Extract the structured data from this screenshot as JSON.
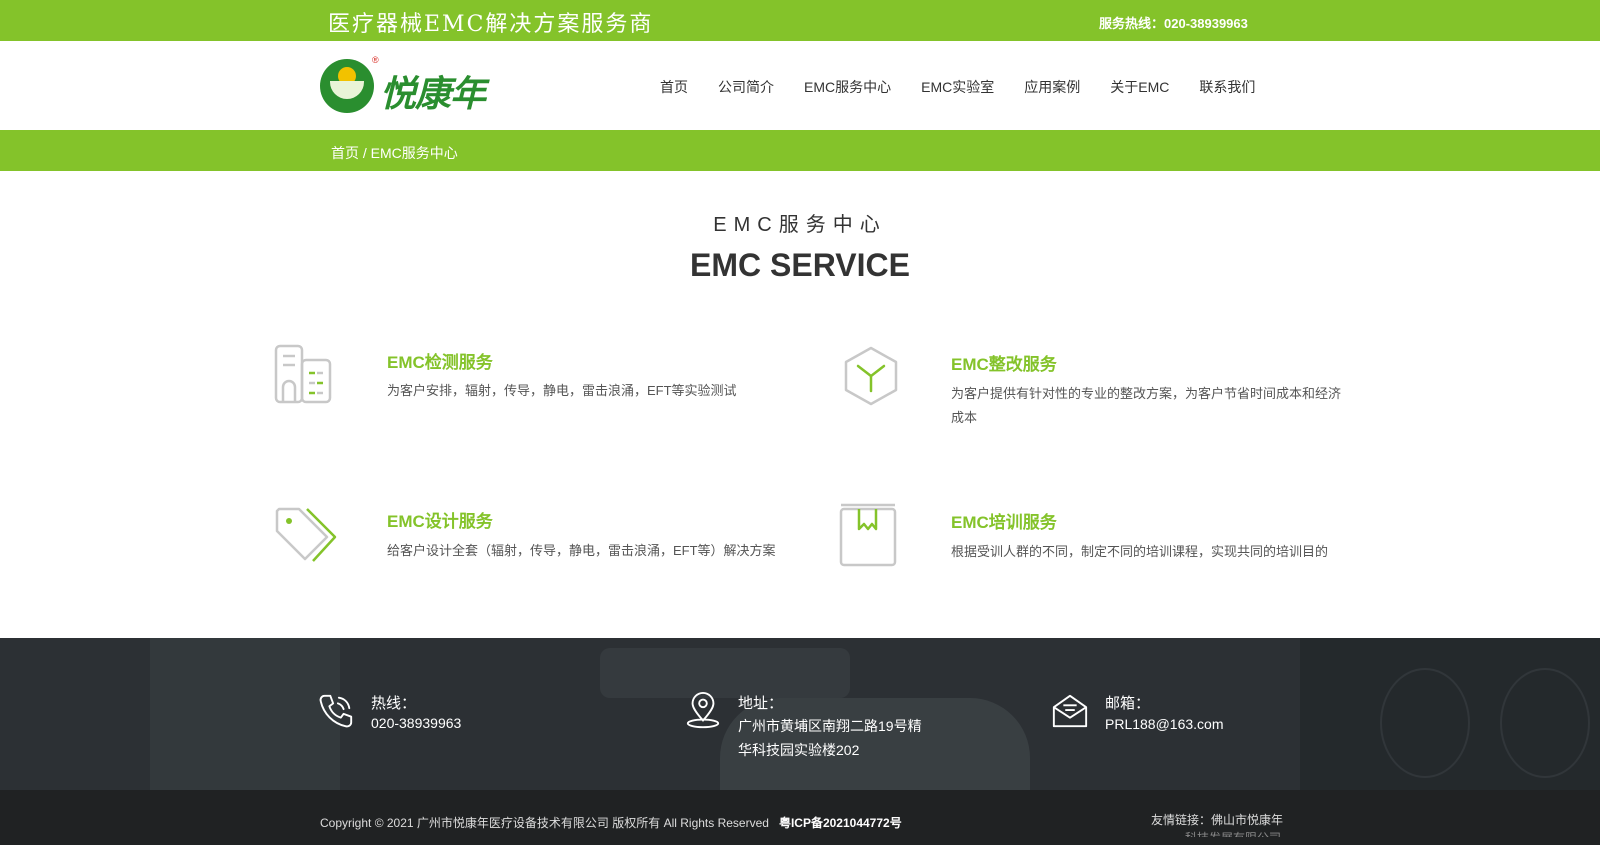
{
  "topbar": {
    "slogan": "医疗器械EMC解决方案服务商",
    "hotline": "服务热线：020-38939963"
  },
  "logo": {
    "brand": "悦康年",
    "mark_text": "悦康年",
    "registered": "®"
  },
  "nav": {
    "items": [
      "首页",
      "公司简介",
      "EMC服务中心",
      "EMC实验室",
      "应用案例",
      "关于EMC",
      "联系我们"
    ]
  },
  "breadcrumb": {
    "home": "首页",
    "sep": " / ",
    "current": "EMC服务中心"
  },
  "section": {
    "title_cn": "EMC服务中心",
    "title_en": "EMC SERVICE"
  },
  "services": [
    {
      "icon": "building-icon",
      "title": "EMC检测服务",
      "desc": "为客户安排，辐射，传导，静电，雷击浪涌，EFT等实验测试"
    },
    {
      "icon": "cube-icon",
      "title": "EMC整改服务",
      "desc": "为客户提供有针对性的专业的整改方案，为客户节省时间成本和经济成本"
    },
    {
      "icon": "tag-icon",
      "title": "EMC设计服务",
      "desc": "给客户设计全套（辐射，传导，静电，雷击浪涌，EFT等）解决方案"
    },
    {
      "icon": "book-icon",
      "title": "EMC培训服务",
      "desc": "根据受训人群的不同，制定不同的培训课程，实现共同的培训目的"
    }
  ],
  "footer": {
    "phone": {
      "icon": "phone-icon",
      "label": "热线：",
      "value": "020-38939963"
    },
    "address": {
      "icon": "location-pin-icon",
      "label": "地址：",
      "line1": "广州市黄埔区南翔二路19号精",
      "line2": "华科技园实验楼202"
    },
    "email": {
      "icon": "envelope-icon",
      "label": "邮箱：",
      "value": "PRL188@163.com"
    }
  },
  "bottom": {
    "copyright": "Copyright © 2021 广州市悦康年医疗设备技术有限公司 版权所有 All Rights Reserved",
    "icp": "粤ICP备2021044772号",
    "links": "友情链接：佛山市悦康年",
    "links_cut": "科技发展有限公司"
  },
  "colors": {
    "brand_green": "#84c32a",
    "logo_green": "#2a8e2f",
    "footer_dark": "#3c4146",
    "bottom_dark": "#202223"
  }
}
